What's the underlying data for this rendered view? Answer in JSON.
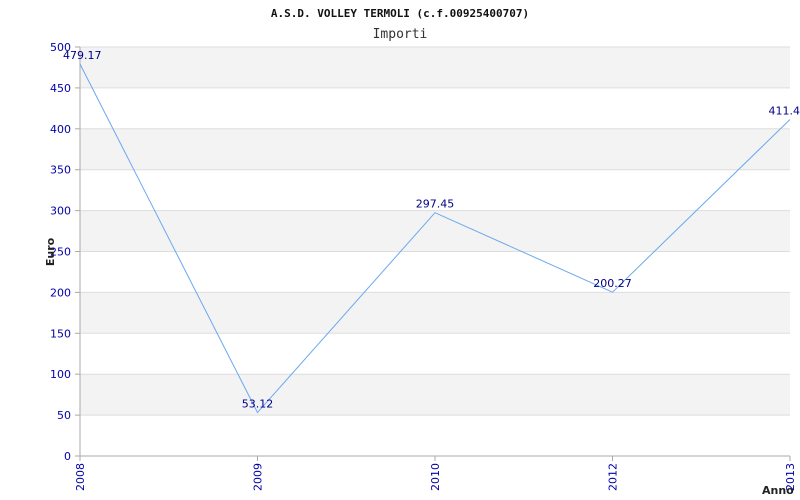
{
  "chart_data": {
    "type": "line",
    "title": "A.S.D. VOLLEY TERMOLI (c.f.00925400707)",
    "subtitle": "Importi",
    "xlabel": "Anno",
    "ylabel": "Euro",
    "x": [
      "2008",
      "2009",
      "2010",
      "2012",
      "2013"
    ],
    "series": [
      {
        "values": [
          479.17,
          53.12,
          297.45,
          200.27,
          411.4
        ],
        "labels": [
          "479.17",
          "53.12",
          "297.45",
          "200.27",
          "411.4"
        ]
      }
    ],
    "ylim": [
      0,
      500
    ],
    "yticks": [
      0,
      50,
      100,
      150,
      200,
      250,
      300,
      350,
      400,
      450,
      500
    ],
    "grid": true,
    "legend": "none",
    "colors": {
      "line": "#6aa8f0",
      "tick_label": "#0000aa",
      "data_label": "#000088",
      "band": "#f3f3f3",
      "grid": "#dddddd",
      "axis": "#aaaaaa"
    }
  }
}
